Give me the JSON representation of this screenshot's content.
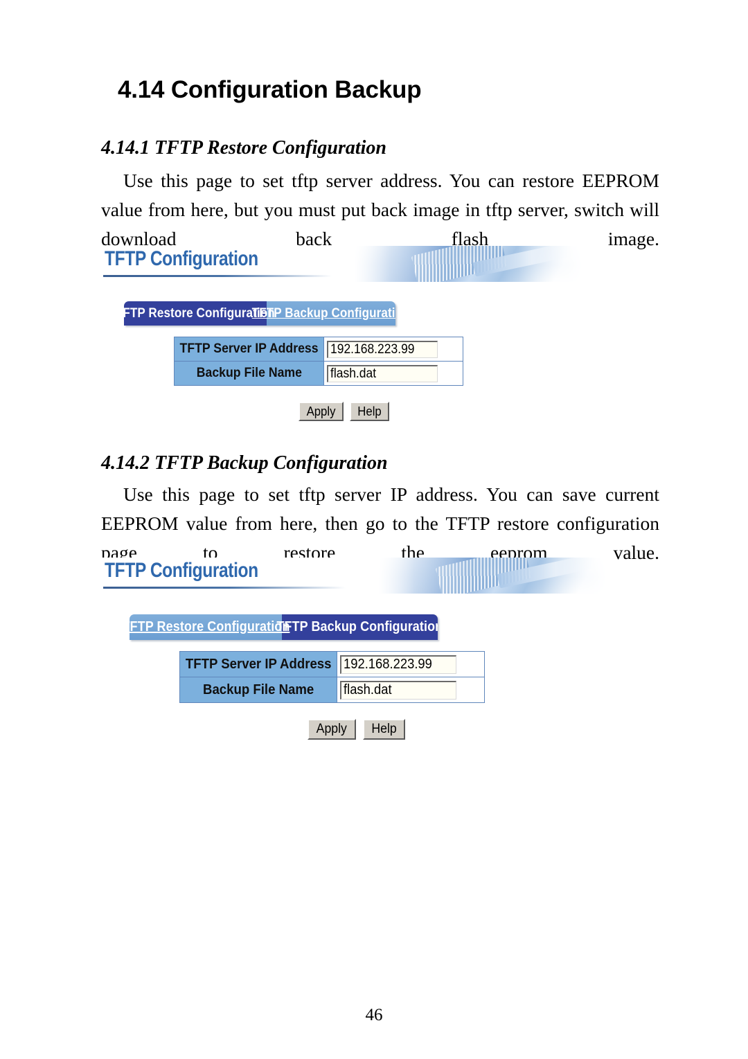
{
  "document": {
    "title": "4.14 Configuration Backup",
    "page_number": "46",
    "sections": [
      {
        "heading": "4.14.1 TFTP Restore Configuration",
        "paragraph": "Use this page to set tftp server address. You can restore EEPROM value from here, but you must put back image in tftp server, switch will download back flash image."
      },
      {
        "heading": "4.14.2 TFTP Backup Configuration",
        "paragraph": "Use this page to set tftp server IP address. You can save current EEPROM value from here, then go to the TFTP restore configuration page to restore the eeprom value."
      }
    ]
  },
  "screenshots": [
    {
      "banner_title": "TFTP Configuration",
      "banner_image": "rj45-cable-photo",
      "tabs": [
        {
          "label": "TFTP Restore Configuration",
          "state": "active"
        },
        {
          "label": "TFTP Backup Configuration",
          "state": "inactive"
        }
      ],
      "form": {
        "rows": [
          {
            "label": "TFTP Server IP Address",
            "value": "192.168.223.99"
          },
          {
            "label": "Backup File Name",
            "value": "flash.dat"
          }
        ]
      },
      "buttons": [
        {
          "label": "Apply"
        },
        {
          "label": "Help"
        }
      ]
    },
    {
      "banner_title": "TFTP Configuration",
      "banner_image": "rj45-cable-photo",
      "tabs": [
        {
          "label": "TFTP Restore Configuration",
          "state": "inactive"
        },
        {
          "label": "TFTP Backup Configuration",
          "state": "active"
        }
      ],
      "form": {
        "rows": [
          {
            "label": "TFTP Server IP Address",
            "value": "192.168.223.99"
          },
          {
            "label": "Backup File Name",
            "value": "flash.dat"
          }
        ]
      },
      "buttons": [
        {
          "label": "Apply"
        },
        {
          "label": "Help"
        }
      ]
    }
  ],
  "colors": {
    "banner_title": "#2f68ad",
    "tab_active": "#33409c",
    "tab_inactive": "#6b9ed2",
    "label_cell": "#7cb0dd",
    "table_border": "#5f86bb",
    "button_face": "#d4d0c8",
    "input_face": "#fffef4"
  }
}
